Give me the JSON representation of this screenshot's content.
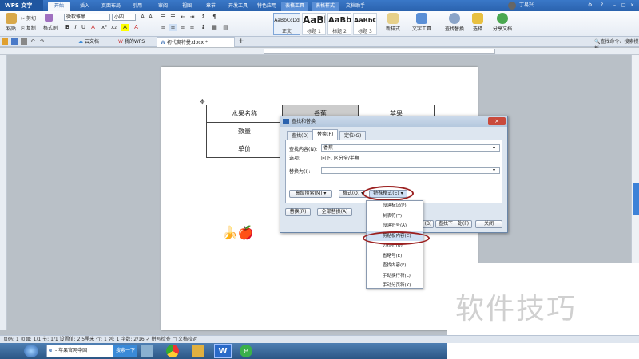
{
  "app": {
    "title": "WPS 文字"
  },
  "menu": {
    "tabs": [
      "开始",
      "插入",
      "页面布局",
      "引用",
      "审阅",
      "视图",
      "章节",
      "开发工具",
      "特色应用",
      "表格工具",
      "表格样式",
      "文档助手"
    ],
    "active": "开始",
    "user": "丁易兴"
  },
  "ribbon": {
    "paste": "粘贴",
    "cut": "剪切",
    "copy": "复制",
    "format_painter": "格式刷",
    "font": "微软雅黑",
    "size": "小四",
    "styles": [
      {
        "preview": "AaBbCcDd",
        "name": "正文"
      },
      {
        "preview": "AaBl",
        "name": "标题 1"
      },
      {
        "preview": "AaBb",
        "name": "标题 2"
      },
      {
        "preview": "AaBbC",
        "name": "标题 3"
      }
    ],
    "new_style": "新样式",
    "text_tools": "文字工具",
    "find_replace": "查找替换",
    "select": "选择",
    "share": "分享文档"
  },
  "tabs": {
    "items": [
      "云文档",
      "我的WPS",
      "初代奥特曼.docx *"
    ],
    "active": "初代奥特曼.docx *",
    "add": "+",
    "search_cmd": "查找命令、搜索模板"
  },
  "document": {
    "table": [
      [
        "水果名称",
        "香蕉",
        "苹果"
      ],
      [
        "数量",
        "",
        ""
      ],
      [
        "单价",
        "",
        ""
      ]
    ],
    "emoji": "🍌🍎"
  },
  "dialog": {
    "title": "查找和替换",
    "close": "×",
    "tabs": [
      "查找(D)",
      "替换(P)",
      "定位(G)"
    ],
    "active_tab": "替换(P)",
    "find_label": "查找内容(N):",
    "find_value": "香蕉",
    "options_label": "选项:",
    "options_value": "向下, 区分全/半角",
    "replace_label": "替换为(I):",
    "replace_value": "",
    "advanced": "高级搜索(M) ▾",
    "format": "格式(O) ▾",
    "special": "特殊格式(E) ▾",
    "replace_btn": "替换(R)",
    "replace_all": "全部替换(A)",
    "find_prev": "(B)",
    "find_next": "查找下一处(F)",
    "close_btn": "关闭"
  },
  "dropdown": {
    "items": [
      "段落标记(P)",
      "制表符(T)",
      "段落符号(A)",
      "剪贴板内容(C)",
      "分栏符(U)",
      "省略号(E)",
      "查找内容(F)",
      "手动换行符(L)",
      "手动分页符(K)"
    ],
    "selected": "剪贴板内容(C)"
  },
  "status": {
    "text": "页码: 1   页面: 1/1   节: 1/1   设置值: 2.5厘米   行: 1   列: 1   字数: 2/16   ✓ 拼写检查   □ 文档校对"
  },
  "taskbar": {
    "ie_label": "- 苹果官网中国",
    "search_btn": "搜索一下"
  },
  "watermark": "软件技巧"
}
